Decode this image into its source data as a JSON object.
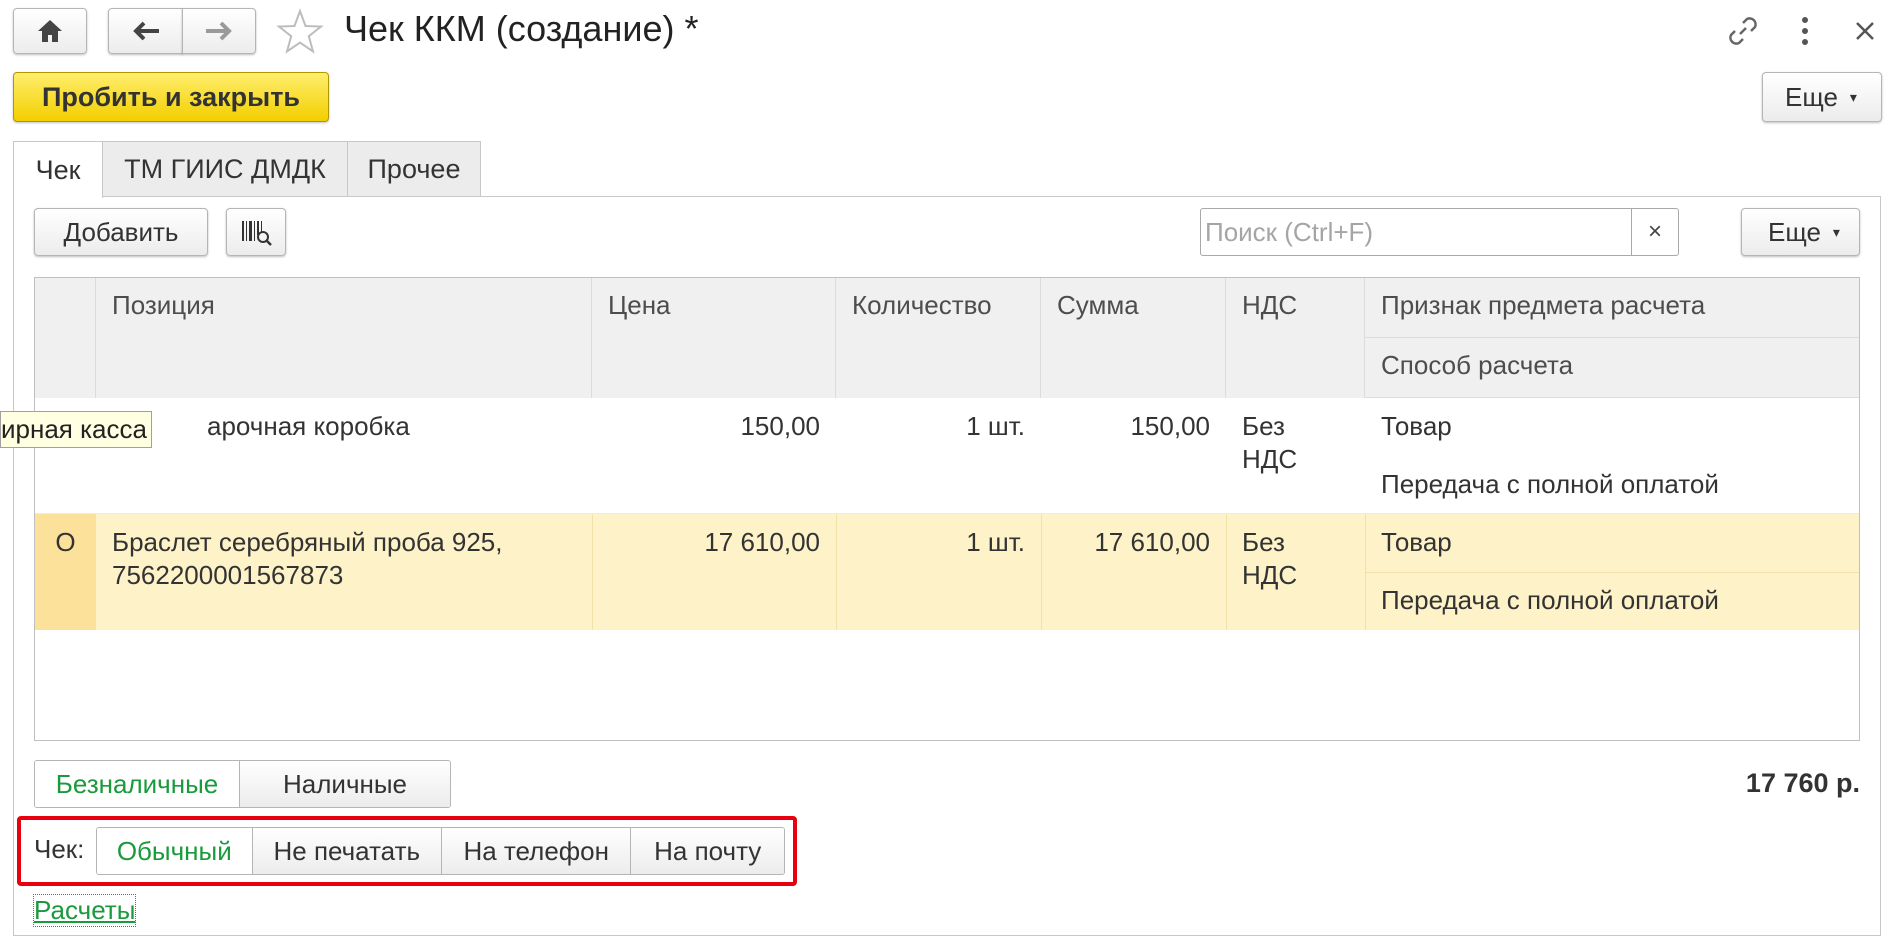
{
  "window": {
    "title": "Чек ККМ (создание) *"
  },
  "toolbar": {
    "primary_label": "Пробить и закрыть",
    "more_label": "Еще"
  },
  "tabs": [
    {
      "label": "Чек"
    },
    {
      "label": "ТМ ГИИС ДМДК"
    },
    {
      "label": "Прочее"
    }
  ],
  "list_toolbar": {
    "add_label": "Добавить",
    "search_placeholder": "Поиск (Ctrl+F)",
    "clear_label": "×",
    "more_label": "Еще"
  },
  "table": {
    "columns": {
      "position": "Позиция",
      "price": "Цена",
      "quantity": "Количество",
      "sum": "Сумма",
      "vat": "НДС",
      "attr": "Признак предмета расчета",
      "method": "Способ расчета"
    },
    "rows": [
      {
        "marker": "",
        "position": "арочная коробка",
        "price": "150,00",
        "quantity": "1 шт.",
        "sum": "150,00",
        "vat": "Без НДС",
        "attr": "Товар",
        "method": "Передача с полной оплатой"
      },
      {
        "marker": "О",
        "position": "Браслет серебряный проба 925, 7562200001567873",
        "price": "17 610,00",
        "quantity": "1 шт.",
        "sum": "17 610,00",
        "vat": "Без НДС",
        "attr": "Товар",
        "method": "Передача с полной оплатой"
      }
    ]
  },
  "tooltip": "ирная касса",
  "payment": {
    "options": [
      "Безналичные",
      "Наличные"
    ],
    "selected": "Безналичные",
    "total": "17 760 р."
  },
  "receipt": {
    "label": "Чек:",
    "options": [
      "Обычный",
      "Не печатать",
      "На телефон",
      "На почту"
    ],
    "selected": "Обычный"
  },
  "links": {
    "calculations": "Расчеты"
  },
  "colors": {
    "accent_green": "#1a9a3c",
    "primary_yellow": "#f7dd1d",
    "selected_row": "#fdf2c8",
    "highlight_red": "#e8000e"
  }
}
